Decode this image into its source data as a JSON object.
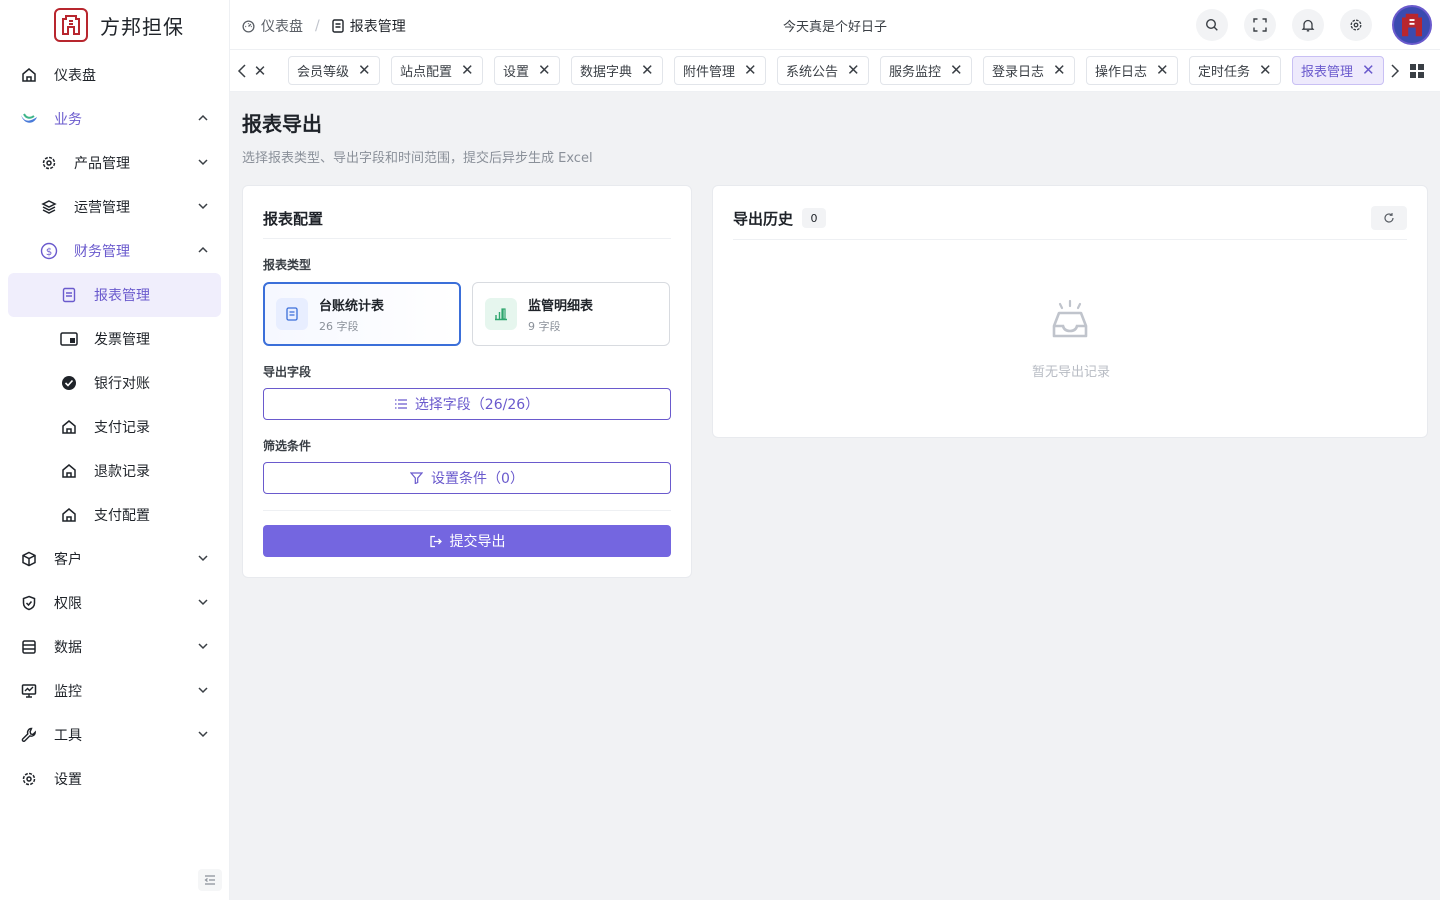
{
  "app": {
    "name": "方邦担保",
    "brand_color": "#6a5acd",
    "logo_color": "#b8262e"
  },
  "header": {
    "breadcrumb": [
      {
        "label": "仪表盘",
        "icon": "dashboard-icon"
      },
      {
        "label": "报表管理",
        "icon": "document-icon"
      }
    ],
    "motto": "今天真是个好日子",
    "actions": [
      "search-icon",
      "fullscreen-icon",
      "bell-icon",
      "gear-icon"
    ]
  },
  "sidebar": {
    "items": [
      {
        "label": "仪表盘",
        "icon": "home-icon"
      },
      {
        "label": "业务",
        "icon": "business-icon",
        "expanded": true
      },
      {
        "label": "产品管理",
        "icon": "gear-icon"
      },
      {
        "label": "运营管理",
        "icon": "layers-icon"
      },
      {
        "label": "财务管理",
        "icon": "dollar-icon",
        "expanded": true
      },
      {
        "label": "报表管理",
        "icon": "document-icon",
        "active": true
      },
      {
        "label": "发票管理",
        "icon": "invoice-icon"
      },
      {
        "label": "银行对账",
        "icon": "check-circle-icon"
      },
      {
        "label": "支付记录",
        "icon": "home-icon"
      },
      {
        "label": "退款记录",
        "icon": "home-icon"
      },
      {
        "label": "支付配置",
        "icon": "home-icon"
      },
      {
        "label": "客户",
        "icon": "cube-icon"
      },
      {
        "label": "权限",
        "icon": "shield-icon"
      },
      {
        "label": "数据",
        "icon": "database-icon"
      },
      {
        "label": "监控",
        "icon": "monitor-icon"
      },
      {
        "label": "工具",
        "icon": "wrench-icon"
      },
      {
        "label": "设置",
        "icon": "gear-icon"
      }
    ]
  },
  "tabs": [
    {
      "label": "会员等级"
    },
    {
      "label": "站点配置"
    },
    {
      "label": "设置"
    },
    {
      "label": "数据字典"
    },
    {
      "label": "附件管理"
    },
    {
      "label": "系统公告"
    },
    {
      "label": "服务监控"
    },
    {
      "label": "登录日志"
    },
    {
      "label": "操作日志"
    },
    {
      "label": "定时任务"
    },
    {
      "label": "报表管理",
      "active": true
    }
  ],
  "page": {
    "title": "报表导出",
    "subtitle": "选择报表类型、导出字段和时间范围，提交后异步生成 Excel"
  },
  "config": {
    "title": "报表配置",
    "type_label": "报表类型",
    "types": [
      {
        "name": "台账统计表",
        "fields": "26 字段",
        "selected": true
      },
      {
        "name": "监管明细表",
        "fields": "9 字段",
        "selected": false
      }
    ],
    "fields_label": "导出字段",
    "fields_button": "选择字段（26/26）",
    "filter_label": "筛选条件",
    "filter_button": "设置条件（0）",
    "submit_button": "提交导出"
  },
  "history": {
    "title": "导出历史",
    "count": "0",
    "empty_text": "暂无导出记录"
  }
}
